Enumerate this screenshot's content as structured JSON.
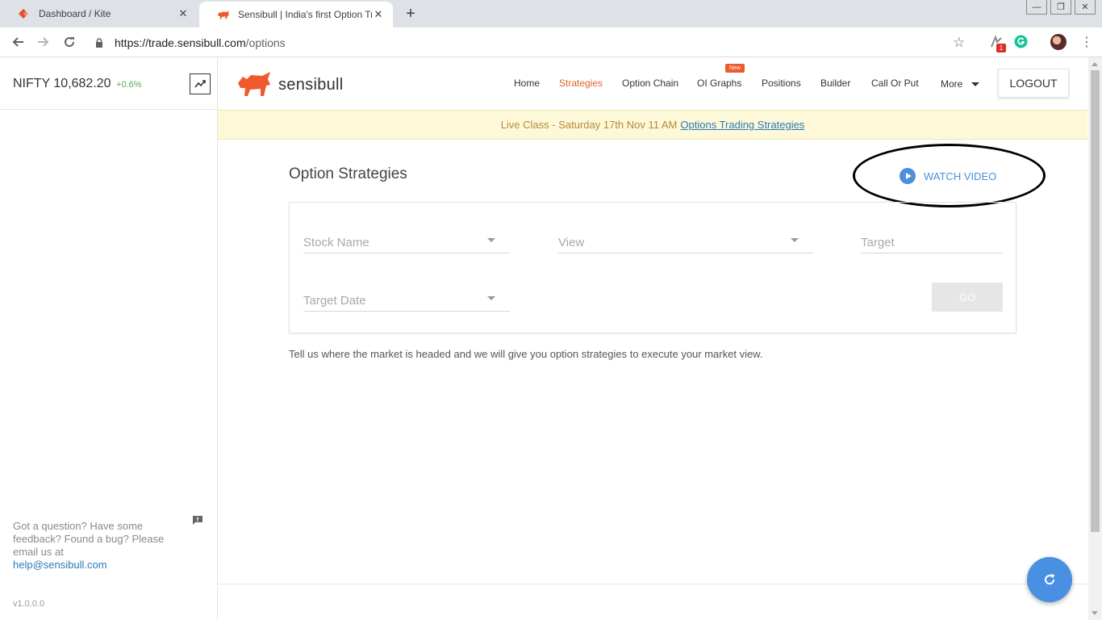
{
  "browser": {
    "tabs": [
      {
        "title": "Dashboard / Kite",
        "active": false
      },
      {
        "title": "Sensibull | India's first Option Tra",
        "active": true
      }
    ],
    "url_host": "https://trade.sensibull.com",
    "url_path": "/options",
    "extension_badge": "1"
  },
  "sidebar": {
    "index_name": "NIFTY",
    "index_value": "10,682.20",
    "index_change": "+0.6%",
    "feedback_text": "Got a question? Have some feedback? Found a bug? Please email us at",
    "feedback_email": "help@sensibull.com",
    "version": "v1.0.0.0"
  },
  "header": {
    "brand": "sensibull",
    "nav": [
      {
        "label": "Home",
        "active": false
      },
      {
        "label": "Strategies",
        "active": true
      },
      {
        "label": "Option Chain",
        "active": false
      },
      {
        "label": "OI Graphs",
        "active": false,
        "badge": "New"
      },
      {
        "label": "Positions",
        "active": false
      },
      {
        "label": "Builder",
        "active": false
      },
      {
        "label": "Call Or Put",
        "active": false
      }
    ],
    "more_label": "More",
    "logout_label": "LOGOUT"
  },
  "banner": {
    "text": "Live Class - Saturday 17th Nov 11 AM",
    "link": "Options Trading Strategies"
  },
  "main": {
    "title": "Option Strategies",
    "watch_video": "WATCH VIDEO",
    "form": {
      "stock_name": "Stock Name",
      "view": "View",
      "target": "Target",
      "target_date": "Target Date",
      "go": "GO"
    },
    "description": "Tell us where the market is headed and we will give you option strategies to execute your market view."
  },
  "colors": {
    "accent": "#e0622b",
    "link": "#2a7ab7",
    "fab": "#4a90e2",
    "banner_bg": "#fdf8d8"
  }
}
